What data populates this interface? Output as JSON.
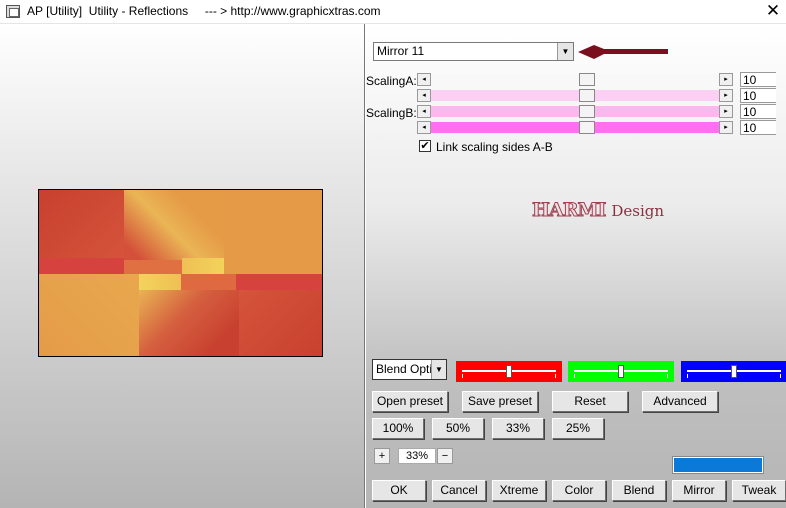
{
  "window": {
    "title": "AP [Utility]  Utility - Reflections     --- > http://www.graphicxtras.com",
    "close": "✕"
  },
  "preset": {
    "value": "Mirror 11",
    "arrow": "▼"
  },
  "scaling": {
    "label_a": "ScalingA:",
    "label_b": "ScalingB:",
    "values": [
      "10",
      "10",
      "10",
      "10"
    ],
    "colors": [
      "#f8f8f8",
      "#fcd0f4",
      "#fbb8ef",
      "#ff6ff0"
    ],
    "arrow_left": "◂",
    "arrow_right": "▸"
  },
  "link": {
    "checked": true,
    "check_mark": "✔",
    "label": "Link scaling sides A-B"
  },
  "watermark": {
    "logo": "HARMI",
    "text": "Design"
  },
  "blend": {
    "value": "Blend Optio",
    "arrow": "▼"
  },
  "color_bars": [
    {
      "color": "#ff0000",
      "level": 0.5
    },
    {
      "color": "#00ff00",
      "level": 0.5
    },
    {
      "color": "#0000ff",
      "level": 0.5
    }
  ],
  "buttons": {
    "open_preset": "Open preset",
    "save_preset": "Save preset",
    "reset": "Reset",
    "advanced": "Advanced",
    "zoom_100": "100%",
    "zoom_50": "50%",
    "zoom_33": "33%",
    "zoom_25": "25%",
    "ok": "OK",
    "cancel": "Cancel",
    "xtreme": "Xtreme",
    "color": "Color",
    "blend": "Blend",
    "mirror": "Mirror",
    "tweak": "Tweak"
  },
  "zoom": {
    "plus": "+",
    "value": "33%",
    "minus": "−"
  },
  "swatch_color": "#0a79d8",
  "annotation_arrow_color": "#7a0f1f"
}
